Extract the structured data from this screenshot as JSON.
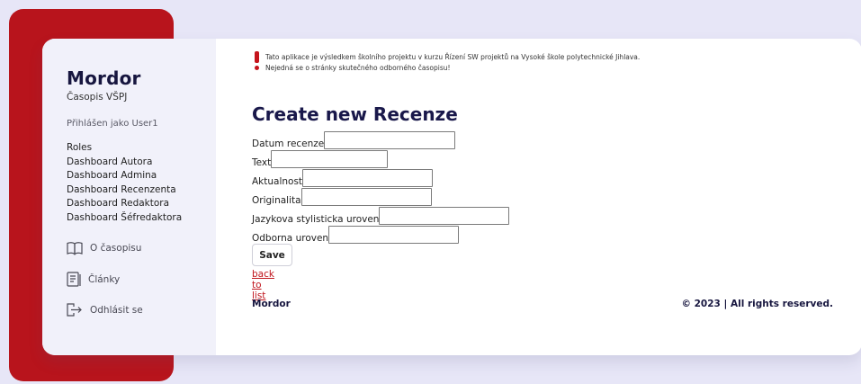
{
  "sidebar": {
    "title": "Mordor",
    "subtitle": "Časopis VŠPJ",
    "logged_in": "Přihlášen jako User1",
    "nav": [
      {
        "label": "Roles"
      },
      {
        "label": "Dashboard Autora"
      },
      {
        "label": "Dashboard Admina"
      },
      {
        "label": "Dashboard Recenzenta"
      },
      {
        "label": "Dashboard Redaktora"
      },
      {
        "label": "Dashboard Šéfredaktora"
      }
    ],
    "about": {
      "label": "O časopisu",
      "icon": "book-icon"
    },
    "articles": {
      "label": "Články",
      "icon": "document-icon"
    },
    "logout": {
      "label": "Odhlásit se",
      "icon": "logout-icon"
    }
  },
  "notice": {
    "line1": "Tato aplikace je výsledkem školního projektu v kurzu Řízení SW projektů na Vysoké škole polytechnické Jihlava.",
    "line2": "Nejedná se o stránky skutečného odborného časopisu!"
  },
  "form": {
    "title": "Create new Recenze",
    "fields": [
      {
        "label": "Datum recenze",
        "value": ""
      },
      {
        "label": "Text",
        "value": ""
      },
      {
        "label": "Aktualnost",
        "value": ""
      },
      {
        "label": "Originalita",
        "value": ""
      },
      {
        "label": "Jazykova stylisticka uroven",
        "value": ""
      },
      {
        "label": "Odborna uroven",
        "value": ""
      }
    ],
    "save_label": "Save",
    "back_label": "back to list"
  },
  "footer": {
    "brand": "Mordor",
    "copyright": "© 2023 | All rights reserved."
  },
  "colors": {
    "accent_red": "#b8141c",
    "navy": "#19184a",
    "background": "#e7e6f7"
  }
}
